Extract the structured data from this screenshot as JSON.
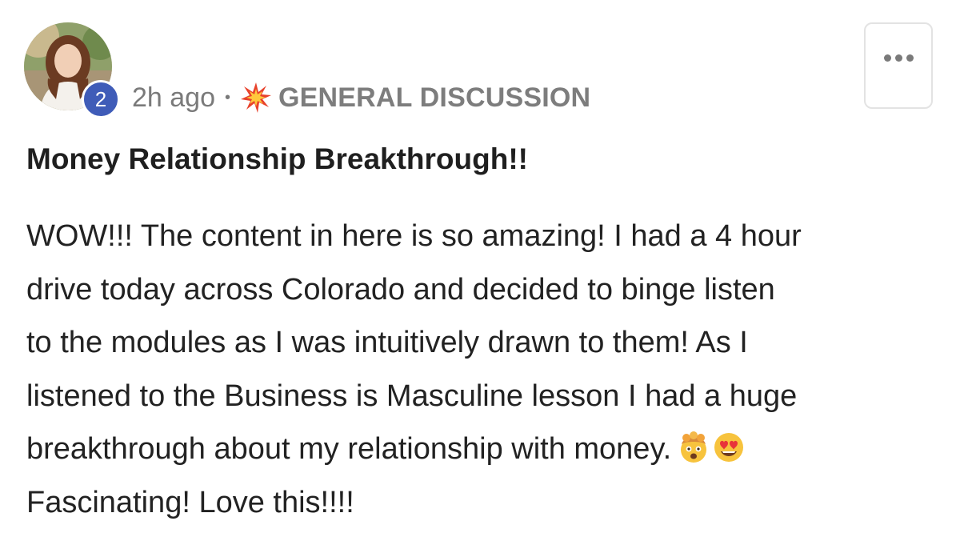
{
  "author": {
    "name": "",
    "level": "2",
    "avatar_icon": "profile-photo"
  },
  "meta": {
    "time_ago": "2h ago",
    "separator": "•",
    "category_icon": "collision-burst-emoji",
    "category": "GENERAL DISCUSSION"
  },
  "actions": {
    "more_icon": "ellipsis-icon"
  },
  "post": {
    "title": "Money Relationship Breakthrough!!",
    "body_lines": [
      "WOW!!! The content in here is so amazing! I had a 4 hour",
      "drive today across Colorado and decided to binge listen",
      "to the modules as I was intuitively drawn to them! As I",
      "listened to the Business is Masculine lesson I had a huge",
      "breakthrough about my relationship with money.",
      "Fascinating! Love this!!!!"
    ],
    "inline_emojis": [
      "exploding-head-emoji",
      "heart-eyes-emoji"
    ]
  },
  "colors": {
    "badge": "#3f5cb8",
    "meta_text": "#7a7a7a",
    "title_text": "#1f1f1f"
  }
}
